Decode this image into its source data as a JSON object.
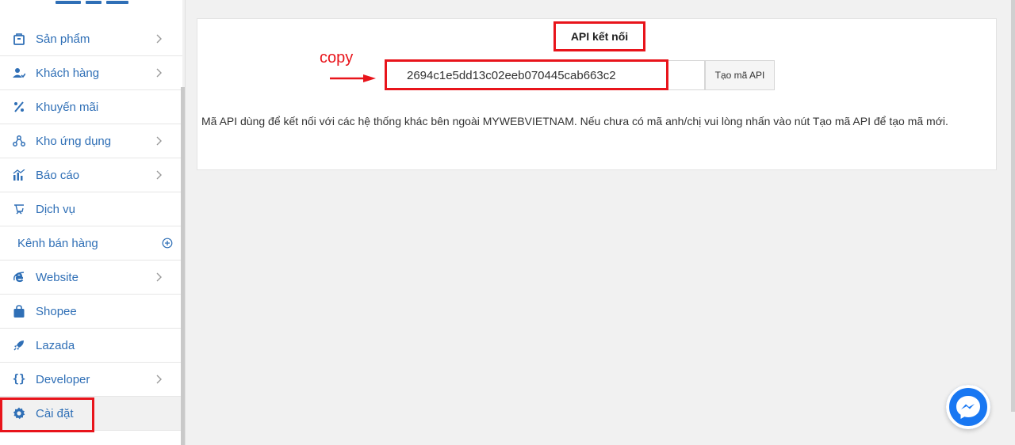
{
  "sidebar": {
    "items": [
      {
        "label": "Sản phẩm",
        "icon": "box-icon",
        "chevron": true
      },
      {
        "label": "Khách hàng",
        "icon": "users-icon",
        "chevron": true
      },
      {
        "label": "Khuyến mãi",
        "icon": "percent-icon",
        "chevron": false
      },
      {
        "label": "Kho ứng dụng",
        "icon": "apps-icon",
        "chevron": true
      },
      {
        "label": "Báo cáo",
        "icon": "chart-icon",
        "chevron": true
      },
      {
        "label": "Dịch vụ",
        "icon": "service-icon",
        "chevron": false
      },
      {
        "label": "Kênh bán hàng",
        "icon": "",
        "chevron": false
      },
      {
        "label": "Website",
        "icon": "ie-icon",
        "chevron": true
      },
      {
        "label": "Shopee",
        "icon": "shopping-bag-icon",
        "chevron": false
      },
      {
        "label": "Lazada",
        "icon": "rocket-icon",
        "chevron": false
      },
      {
        "label": "Developer",
        "icon": "braces-icon",
        "chevron": true
      },
      {
        "label": "Cài đặt",
        "icon": "gear-icon",
        "chevron": false
      }
    ]
  },
  "main": {
    "title": "API kết nối",
    "copy_annotation": "copy",
    "api_key": "2694c1e5dd13c02eeb070445cab663c2",
    "generate_button": "Tạo mã API",
    "description": "Mã API dùng để kết nối với các hệ thống khác bên ngoài MYWEBVIETNAM. Nếu chưa có mã anh/chị vui lòng nhấn vào nút Tạo mã API để tạo mã mới."
  },
  "colors": {
    "accent": "#2f6fb6",
    "highlight": "#e8141b",
    "messenger": "#1877f2"
  }
}
